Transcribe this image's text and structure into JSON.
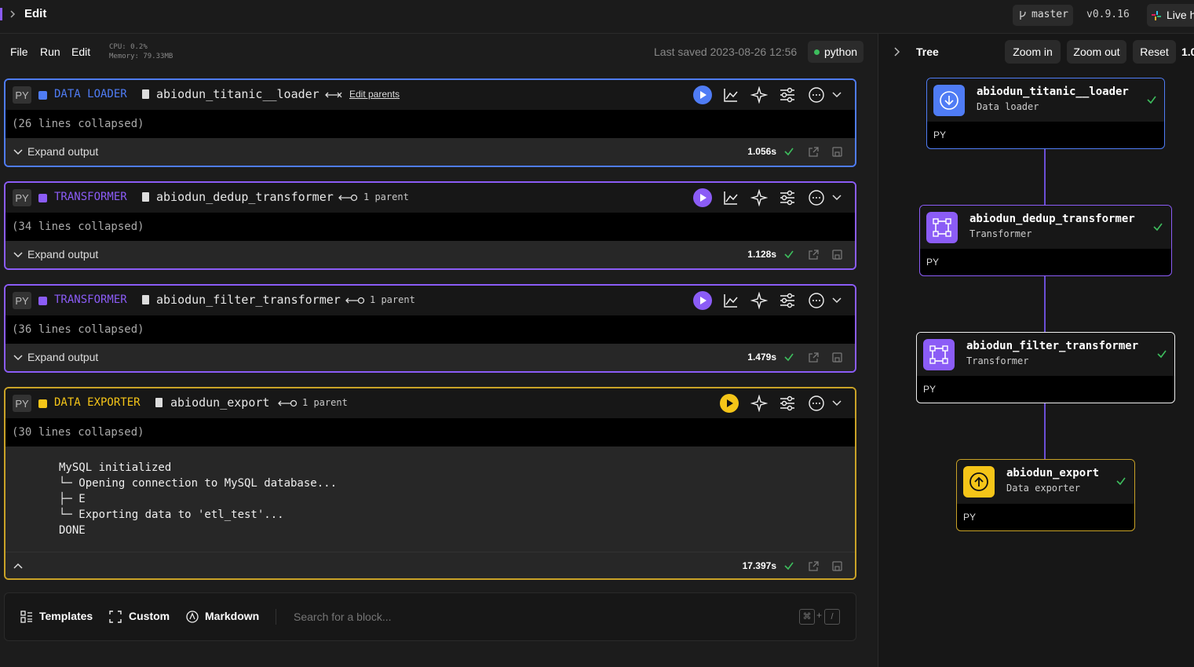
{
  "topbar": {
    "title": "Edit",
    "branch": "master",
    "version": "v0.9.16",
    "live": "Live h"
  },
  "menu": {
    "file": "File",
    "run": "Run",
    "edit": "Edit",
    "cpu": "CPU: 0.2%",
    "memory": "Memory: 79.33MB",
    "last_saved": "Last saved 2023-08-26 12:56",
    "kernel": "python"
  },
  "blocks": [
    {
      "py": "PY",
      "type": "DATA LOADER",
      "name": "abiodun_titanic__loader",
      "parent_text": "Edit parents",
      "collapsed": "(26 lines collapsed)",
      "expand": "Expand output",
      "duration": "1.056s",
      "color": "#4f7cf5"
    },
    {
      "py": "PY",
      "type": "TRANSFORMER",
      "name": "abiodun_dedup_transformer",
      "parent_text": "1 parent",
      "collapsed": "(34 lines collapsed)",
      "expand": "Expand output",
      "duration": "1.128s",
      "color": "#8b5cf6"
    },
    {
      "py": "PY",
      "type": "TRANSFORMER",
      "name": "abiodun_filter_transformer",
      "parent_text": "1 parent",
      "collapsed": "(36 lines collapsed)",
      "expand": "Expand output",
      "duration": "1.479s",
      "color": "#8b5cf6"
    },
    {
      "py": "PY",
      "type": "DATA EXPORTER",
      "name": "abiodun_export",
      "parent_text": "1 parent",
      "collapsed": "(30 lines collapsed)",
      "duration": "17.397s",
      "color": "#f5c518",
      "output": [
        "MySQL initialized",
        "└─ Opening connection to MySQL database...",
        "├─ E",
        "└─ Exporting data to 'etl_test'...",
        "DONE"
      ]
    }
  ],
  "bottom": {
    "templates": "Templates",
    "custom": "Custom",
    "markdown": "Markdown",
    "search_placeholder": "Search for a block..."
  },
  "tree": {
    "tab": "Tree",
    "zoom_in": "Zoom in",
    "zoom_out": "Zoom out",
    "reset": "Reset",
    "zoom_level": "1.0",
    "nodes": [
      {
        "name": "abiodun_titanic__loader",
        "type": "Data loader",
        "py": "PY"
      },
      {
        "name": "abiodun_dedup_transformer",
        "type": "Transformer",
        "py": "PY"
      },
      {
        "name": "abiodun_filter_transformer",
        "type": "Transformer",
        "py": "PY"
      },
      {
        "name": "abiodun_export",
        "type": "Data exporter",
        "py": "PY"
      }
    ]
  },
  "colors": {
    "loader": "#4f7cf5",
    "transformer": "#8b5cf6",
    "exporter": "#f5c518",
    "success": "#3dbd5d"
  },
  "icons": [
    "chevron-right-icon",
    "git-branch-icon",
    "slack-icon",
    "play-icon",
    "chart-icon",
    "sparkle-icon",
    "sliders-icon",
    "more-icon",
    "chevron-down-icon",
    "file-icon",
    "check-icon",
    "external-link-icon",
    "save-icon",
    "download-icon",
    "frame-icon",
    "upload-icon",
    "templates-icon",
    "custom-icon",
    "markdown-icon"
  ]
}
